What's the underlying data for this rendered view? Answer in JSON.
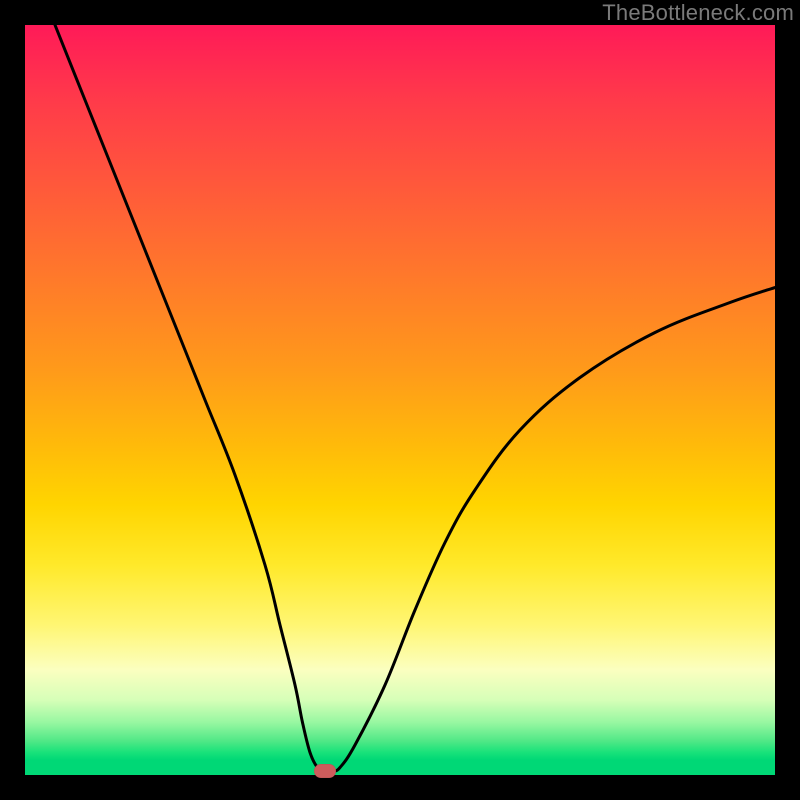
{
  "watermark": "TheBottleneck.com",
  "colors": {
    "curve": "#000000",
    "marker": "#cd5c5c",
    "frame": "#000000"
  },
  "chart_data": {
    "type": "line",
    "title": "",
    "xlabel": "",
    "ylabel": "",
    "xlim": [
      0,
      100
    ],
    "ylim": [
      0,
      100
    ],
    "grid": false,
    "series": [
      {
        "name": "bottleneck-curve",
        "x": [
          4,
          8,
          12,
          16,
          20,
          24,
          28,
          32,
          34,
          36,
          37,
          38,
          39,
          40,
          41,
          42,
          44,
          48,
          52,
          56,
          60,
          66,
          74,
          84,
          94,
          100
        ],
        "y": [
          100,
          90,
          80,
          70,
          60,
          50,
          40,
          28,
          20,
          12,
          7,
          3,
          1,
          0.5,
          0.5,
          1,
          4,
          12,
          22,
          31,
          38,
          46,
          53,
          59,
          63,
          65
        ]
      }
    ],
    "annotations": [
      {
        "name": "optimal-marker",
        "x": 40,
        "y": 0.5
      }
    ]
  }
}
